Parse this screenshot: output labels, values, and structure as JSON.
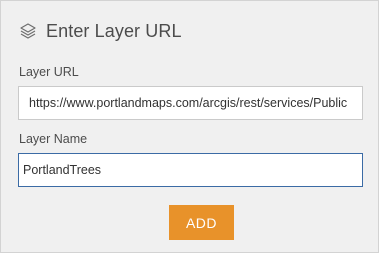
{
  "header": {
    "icon": "layers-icon",
    "title": "Enter Layer URL"
  },
  "form": {
    "url_label": "Layer URL",
    "url_value": "https://www.portlandmaps.com/arcgis/rest/services/Public",
    "name_label": "Layer Name",
    "name_value": "PortlandTrees",
    "add_label": "ADD"
  },
  "colors": {
    "panel_background": "#f0f0f0",
    "add_button": "#e8922a",
    "focus_border": "#3b6ba5"
  }
}
